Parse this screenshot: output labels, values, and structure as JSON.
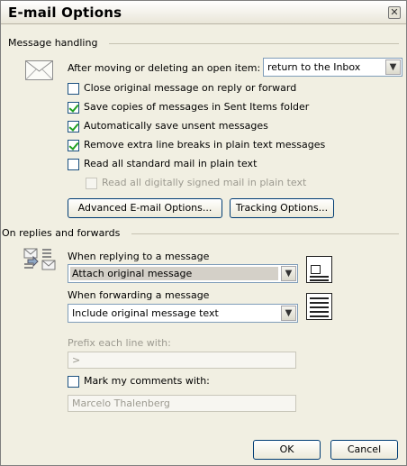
{
  "dialog": {
    "title": "E-mail Options"
  },
  "message_handling": {
    "group_label": "Message handling",
    "after_moving_label": "After moving or deleting an open item:",
    "after_moving_value": "return to the Inbox",
    "options": [
      {
        "label": "Close original message on reply or forward",
        "checked": false,
        "enabled": true
      },
      {
        "label": "Save copies of messages in Sent Items folder",
        "checked": true,
        "enabled": true
      },
      {
        "label": "Automatically save unsent messages",
        "checked": true,
        "enabled": true
      },
      {
        "label": "Remove extra line breaks in plain text messages",
        "checked": true,
        "enabled": true
      },
      {
        "label": "Read all standard mail in plain text",
        "checked": false,
        "enabled": true
      },
      {
        "label": "Read all digitally signed mail in plain text",
        "checked": false,
        "enabled": false
      }
    ],
    "advanced_button": "Advanced E-mail Options...",
    "tracking_button": "Tracking Options..."
  },
  "replies_forwards": {
    "group_label": "On replies and forwards",
    "reply_label": "When replying to a message",
    "reply_value": "Attach original message",
    "forward_label": "When forwarding a message",
    "forward_value": "Include original message text",
    "prefix_label": "Prefix each line with:",
    "prefix_value": ">",
    "mark_comments_label": "Mark my comments with:",
    "mark_comments_checked": false,
    "mark_comments_value": "Marcelo Thalenberg"
  },
  "footer": {
    "ok": "OK",
    "cancel": "Cancel"
  },
  "colors": {
    "dialog_bg": "#f1efe2",
    "checkmark": "#21a121",
    "border_blue": "#7f9db9"
  }
}
